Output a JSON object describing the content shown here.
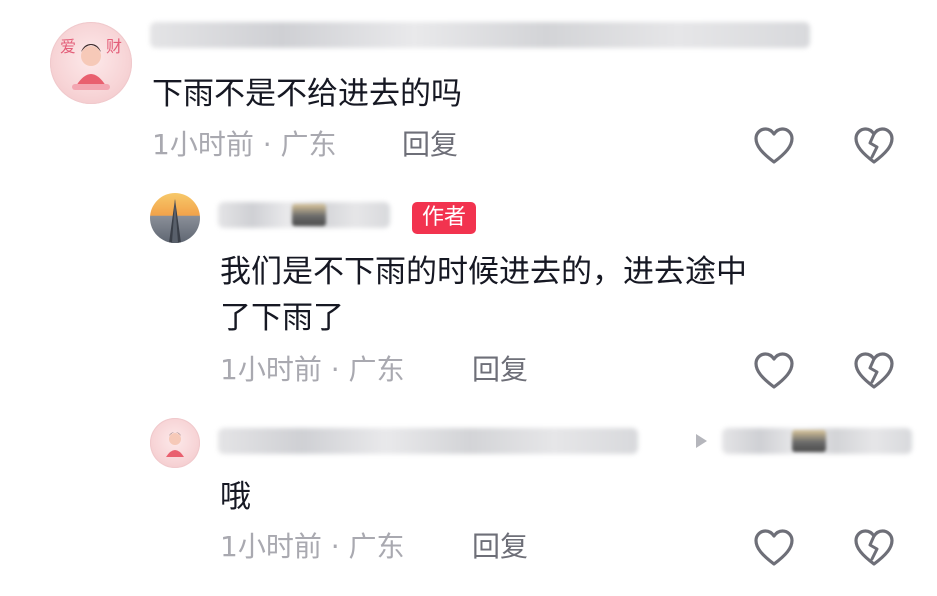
{
  "comments": [
    {
      "id": "c1",
      "avatar": {
        "icon": "avatar-pink-cartoon",
        "chars": "爱  财"
      },
      "text": "下雨不是不给进去的吗",
      "time": "1小时前",
      "location": "广东",
      "reply_label": "回复",
      "meta_sep": "·"
    },
    {
      "id": "c2",
      "avatar": {
        "icon": "avatar-sunset-tower"
      },
      "badge": "作者",
      "text_line1": "我们是不下雨的时候进去的，进去途中",
      "text_line2": "了下雨了",
      "time": "1小时前",
      "location": "广东",
      "reply_label": "回复",
      "meta_sep": "·"
    },
    {
      "id": "c3",
      "avatar": {
        "icon": "avatar-pink-cartoon"
      },
      "text": "哦",
      "time": "1小时前",
      "location": "广东",
      "reply_label": "回复",
      "meta_sep": "·"
    }
  ],
  "icons": {
    "like": "heart-outline-icon",
    "dislike": "broken-heart-outline-icon",
    "reply_arrow": "play-triangle-icon"
  },
  "colors": {
    "text": "#161823",
    "meta": "#a9a9b0",
    "reply": "#6e6f78",
    "badge": "#f2334f",
    "icon": "#6e6f78"
  }
}
